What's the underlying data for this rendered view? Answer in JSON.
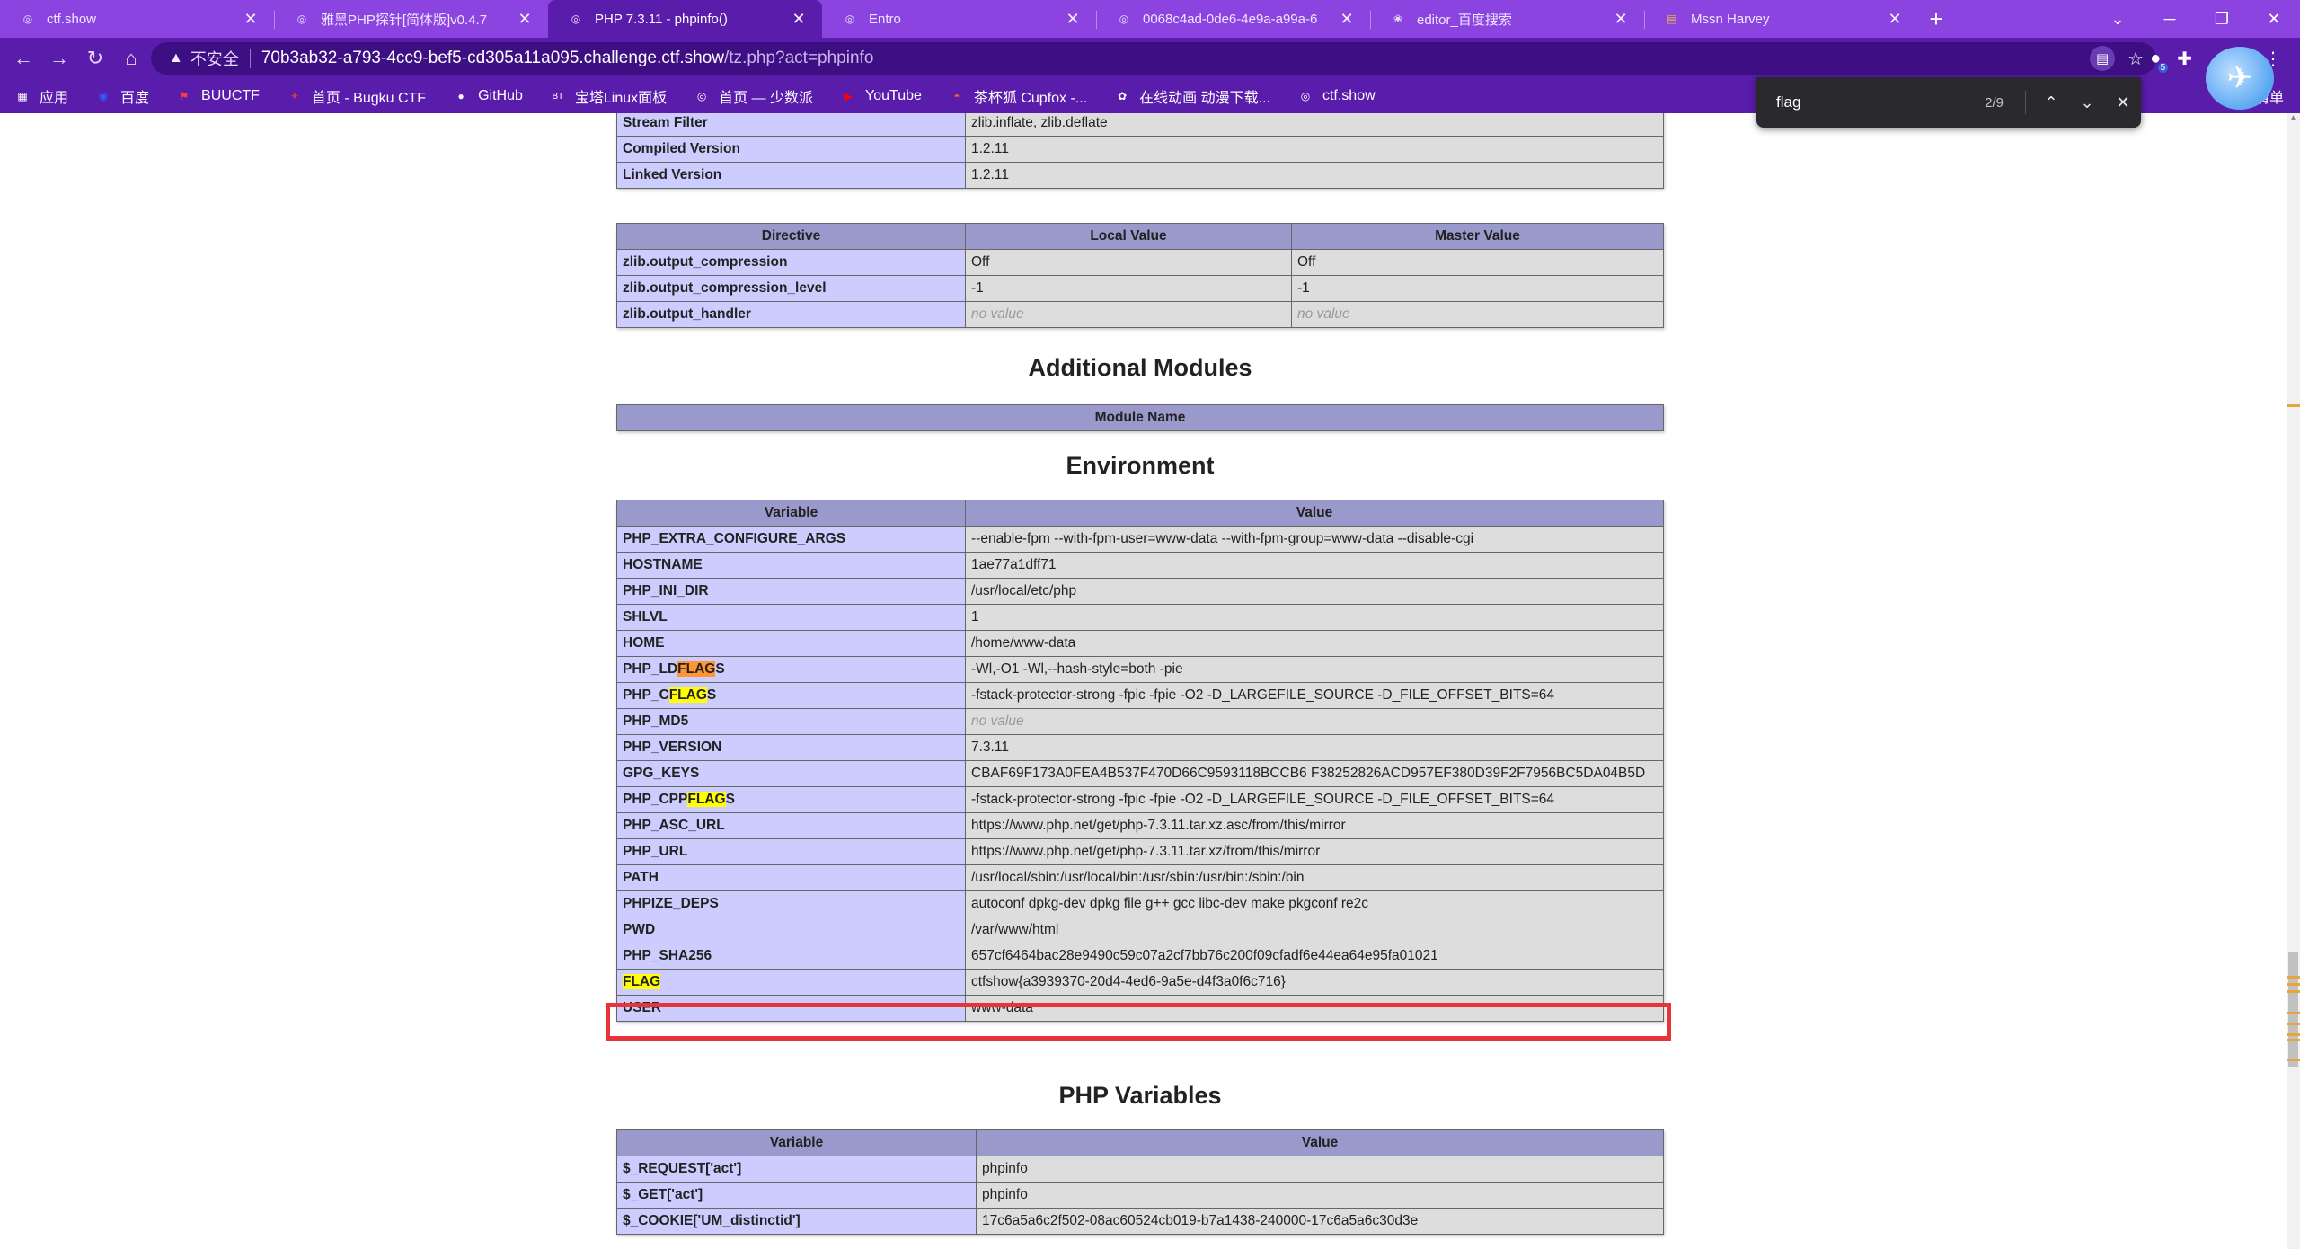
{
  "tabs": [
    {
      "title": "ctf.show",
      "icon": "globe-icon"
    },
    {
      "title": "雅黑PHP探针[简体版]v0.4.7",
      "icon": "globe-icon"
    },
    {
      "title": "PHP 7.3.11 - phpinfo()",
      "icon": "globe-icon",
      "active": true
    },
    {
      "title": "Entro",
      "icon": "globe-icon"
    },
    {
      "title": "0068c4ad-0de6-4e9a-a99a-6",
      "icon": "globe-icon"
    },
    {
      "title": "editor_百度搜索",
      "icon": "paw-icon"
    },
    {
      "title": "Mssn Harvey",
      "icon": "doc-icon"
    }
  ],
  "toolbar": {
    "security_label": "不安全",
    "url_host": "70b3ab32-a793-4cc9-bef5-cd305a11a095.challenge.ctf.show",
    "url_path": "/tz.php?act=phpinfo",
    "extension_badge": "5"
  },
  "bookmarks": [
    {
      "label": "应用",
      "icon": "apps-icon"
    },
    {
      "label": "百度",
      "icon": "baidu-icon"
    },
    {
      "label": "BUUCTF",
      "icon": "flag-icon"
    },
    {
      "label": "首页 - Bugku CTF",
      "icon": "bugku-icon"
    },
    {
      "label": "GitHub",
      "icon": "github-icon"
    },
    {
      "label": "宝塔Linux面板",
      "icon": "bt-icon"
    },
    {
      "label": "首页 — 少数派",
      "icon": "globe-icon"
    },
    {
      "label": "YouTube",
      "icon": "youtube-icon"
    },
    {
      "label": "茶杯狐 Cupfox -...",
      "icon": "cupfox-icon"
    },
    {
      "label": "在线动画 动漫下载...",
      "icon": "anime-icon"
    },
    {
      "label": "ctf.show",
      "icon": "globe-icon"
    }
  ],
  "bookmarks_right": "清单",
  "findbar": {
    "query": "flag",
    "count": "2/9"
  },
  "zlib_table": {
    "rows": [
      {
        "name": "Stream Filter",
        "value": "zlib.inflate, zlib.deflate"
      },
      {
        "name": "Compiled Version",
        "value": "1.2.11"
      },
      {
        "name": "Linked Version",
        "value": "1.2.11"
      }
    ]
  },
  "directive_table": {
    "headers": [
      "Directive",
      "Local Value",
      "Master Value"
    ],
    "rows": [
      {
        "name": "zlib.output_compression",
        "local": "Off",
        "master": "Off"
      },
      {
        "name": "zlib.output_compression_level",
        "local": "-1",
        "master": "-1"
      },
      {
        "name": "zlib.output_handler",
        "local": "no value",
        "master": "no value"
      }
    ]
  },
  "additional_modules": {
    "heading": "Additional Modules",
    "header": "Module Name"
  },
  "environment": {
    "heading": "Environment",
    "headers": [
      "Variable",
      "Value"
    ],
    "rows": [
      {
        "name": "PHP_EXTRA_CONFIGURE_ARGS",
        "value": "--enable-fpm --with-fpm-user=www-data --with-fpm-group=www-data --disable-cgi"
      },
      {
        "name": "HOSTNAME",
        "value": "1ae77a1dff71"
      },
      {
        "name": "PHP_INI_DIR",
        "value": "/usr/local/etc/php"
      },
      {
        "name": "SHLVL",
        "value": "1"
      },
      {
        "name": "HOME",
        "value": "/home/www-data"
      },
      {
        "name_pre": "PHP_LD",
        "name_hl": "FLAG",
        "name_post": "S",
        "hl_current": true,
        "value": "-Wl,-O1 -Wl,--hash-style=both -pie"
      },
      {
        "name_pre": "PHP_C",
        "name_hl": "FLAG",
        "name_post": "S",
        "value": "-fstack-protector-strong -fpic -fpie -O2 -D_LARGEFILE_SOURCE -D_FILE_OFFSET_BITS=64"
      },
      {
        "name": "PHP_MD5",
        "value": "no value",
        "novalue": true
      },
      {
        "name": "PHP_VERSION",
        "value": "7.3.11"
      },
      {
        "name": "GPG_KEYS",
        "value": "CBAF69F173A0FEA4B537F470D66C9593118BCCB6 F38252826ACD957EF380D39F2F7956BC5DA04B5D"
      },
      {
        "name_pre": "PHP_CPP",
        "name_hl": "FLAG",
        "name_post": "S",
        "value": "-fstack-protector-strong -fpic -fpie -O2 -D_LARGEFILE_SOURCE -D_FILE_OFFSET_BITS=64"
      },
      {
        "name": "PHP_ASC_URL",
        "value": "https://www.php.net/get/php-7.3.11.tar.xz.asc/from/this/mirror"
      },
      {
        "name": "PHP_URL",
        "value": "https://www.php.net/get/php-7.3.11.tar.xz/from/this/mirror"
      },
      {
        "name": "PATH",
        "value": "/usr/local/sbin:/usr/local/bin:/usr/sbin:/usr/bin:/sbin:/bin"
      },
      {
        "name": "PHPIZE_DEPS",
        "value": "autoconf dpkg-dev dpkg file g++ gcc libc-dev make pkgconf re2c"
      },
      {
        "name": "PWD",
        "value": "/var/www/html"
      },
      {
        "name": "PHP_SHA256",
        "value": "657cf6464bac28e9490c59c07a2cf7bb76c200f09cfadf6e44ea64e95fa01021"
      },
      {
        "name_pre": "",
        "name_hl": "FLAG",
        "name_post": "",
        "value": "ctfshow{a3939370-20d4-4ed6-9a5e-d4f3a0f6c716}",
        "boxed": true
      },
      {
        "name": "USER",
        "value": "www-data"
      }
    ]
  },
  "php_variables": {
    "heading": "PHP Variables",
    "headers": [
      "Variable",
      "Value"
    ],
    "rows": [
      {
        "name": "$_REQUEST['act']",
        "value": "phpinfo"
      },
      {
        "name": "$_GET['act']",
        "value": "phpinfo"
      },
      {
        "name": "$_COOKIE['UM_distinctid']",
        "value": "17c6a5a6c2f502-08ac60524cb019-b7a1438-240000-17c6a5a6c30d3e"
      }
    ]
  },
  "colors": {
    "tab_strip": "#8c44e0",
    "toolbar": "#5a1cab",
    "table_header": "#9999cc",
    "row_label": "#ccccff",
    "row_value": "#dddddd",
    "find_highlight": "#ffff00",
    "find_current": "#ff9632",
    "annotation_box": "#e8333a"
  }
}
